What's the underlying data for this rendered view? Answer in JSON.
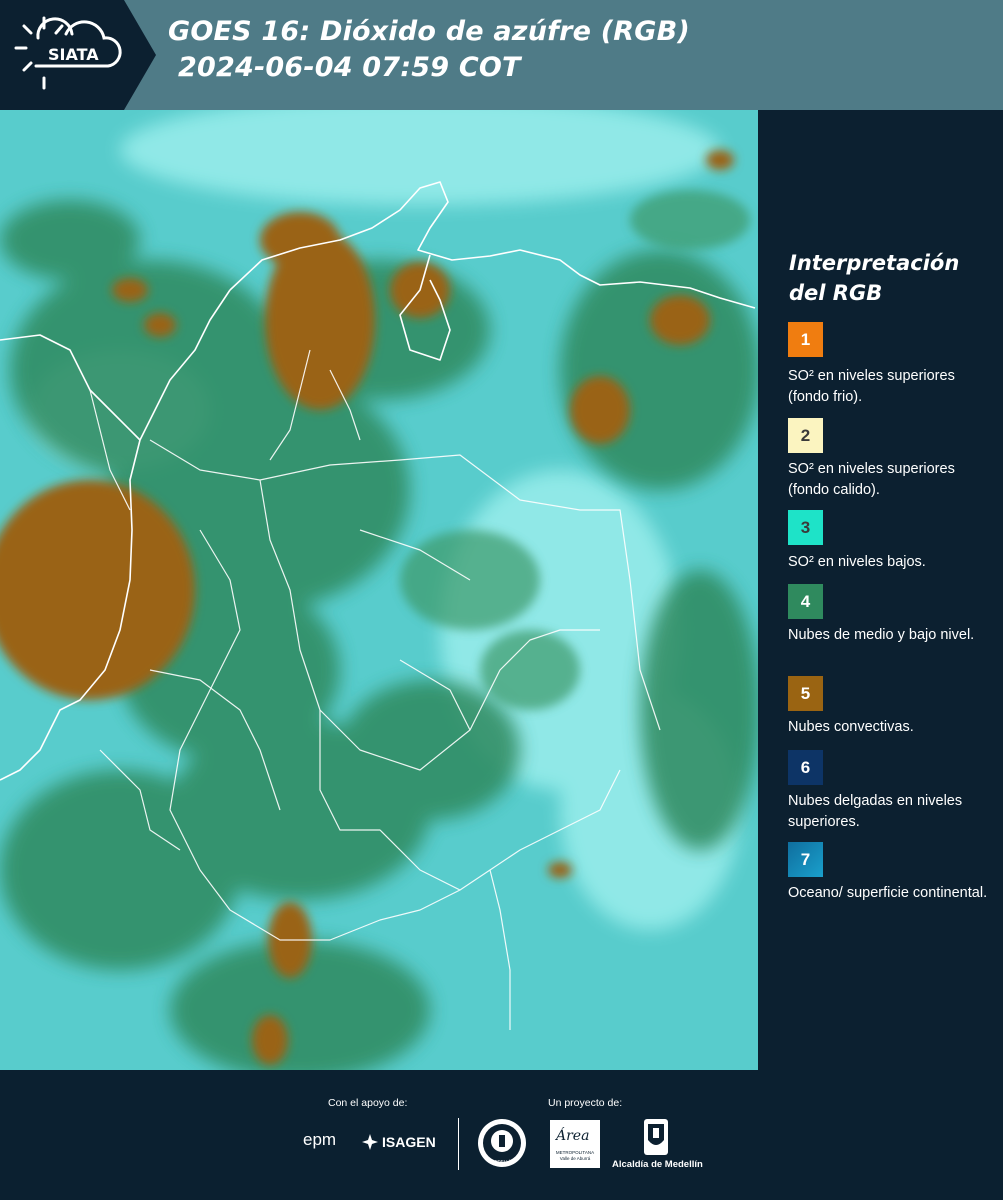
{
  "header": {
    "logo_text": "SIATA",
    "title_line1": "GOES 16: Dióxido de azúfre (RGB)",
    "title_line2": "2024-06-04 07:59 COT"
  },
  "legend": {
    "title": "Interpretación del RGB",
    "items": [
      {
        "number": "1",
        "color": "#f07d10",
        "text": "SO² en niveles superiores (fondo frio)."
      },
      {
        "number": "2",
        "color": "#fbf4c0",
        "text": "SO² en niveles superiores (fondo calido)."
      },
      {
        "number": "3",
        "color": "#1ee3c8",
        "text": "SO² en niveles bajos."
      },
      {
        "number": "4",
        "color": "#2f8a5e",
        "text": "Nubes de medio y bajo nivel."
      },
      {
        "number": "5",
        "color": "#9a6412",
        "text": "Nubes convectivas."
      },
      {
        "number": "6",
        "color": "#0d3466",
        "text": "Nubes delgadas en niveles superiores."
      },
      {
        "number": "7",
        "color": "#1586b8",
        "text": "Oceano/ superficie continental."
      }
    ]
  },
  "footer": {
    "support_label": "Con el apoyo de:",
    "project_label": "Un proyecto de:",
    "epm": "epm",
    "isagen": "ISAGEN",
    "area_brand": "Área",
    "area_caption": "METROPOLITANA Valle de Aburrá",
    "medellin_seal_text": "MEDELLÍN",
    "alcaldia": "Alcaldía de Medellín"
  },
  "colors": {
    "header_bg": "#4f7b87",
    "panel_bg": "#0c2030",
    "cyan_surface": "#58cccc",
    "cloud_green": "#2f8a5e",
    "convective_brown": "#9a6412"
  }
}
